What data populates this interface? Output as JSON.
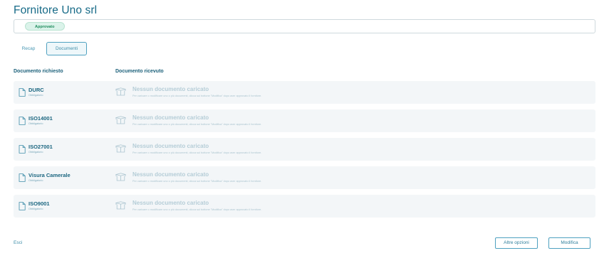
{
  "header": {
    "title": "Fornitore Uno srl"
  },
  "status": {
    "label": "Approvato"
  },
  "tabs": [
    {
      "label": "Recap",
      "active": false
    },
    {
      "label": "Documenti",
      "active": true
    }
  ],
  "columns": {
    "requested": "Documento richiesto",
    "received": "Documento ricevuto"
  },
  "documents": [
    {
      "name": "DURC",
      "requirement": "Obbligatorio",
      "status_title": "Nessun documento caricato",
      "status_desc": "Per caricare o modificare uno o più documenti, clicca sul bottone \"Modifica\" dopo aver approvato il fornitore."
    },
    {
      "name": "ISO14001",
      "requirement": "Obbligatorio",
      "status_title": "Nessun documento caricato",
      "status_desc": "Per caricare o modificare uno o più documenti, clicca sul bottone \"Modifica\" dopo aver approvato il fornitore."
    },
    {
      "name": "ISO27001",
      "requirement": "Obbligatorio",
      "status_title": "Nessun documento caricato",
      "status_desc": "Per caricare o modificare uno o più documenti, clicca sul bottone \"Modifica\" dopo aver approvato il fornitore."
    },
    {
      "name": "Visura Camerale",
      "requirement": "Obbligatorio",
      "status_title": "Nessun documento caricato",
      "status_desc": "Per caricare o modificare uno o più documenti, clicca sul bottone \"Modifica\" dopo aver approvato il fornitore."
    },
    {
      "name": "ISO9001",
      "requirement": "Obbligatorio",
      "status_title": "Nessun documento caricato",
      "status_desc": "Per caricare o modificare uno o più documenti, clicca sul bottone \"Modifica\" dopo aver approvato il fornitore."
    }
  ],
  "footer": {
    "exit_label": "Esci",
    "more_options_label": "Altre opzioni",
    "edit_label": "Modifica"
  },
  "icons": {
    "document": "document-icon",
    "empty_box": "empty-box-icon"
  },
  "colors": {
    "primary": "#166a87",
    "accent": "#4fa1c0",
    "approved_bg": "#dbf3ea",
    "approved_text": "#1f8d5e",
    "row_bg": "#f3f6f8"
  }
}
